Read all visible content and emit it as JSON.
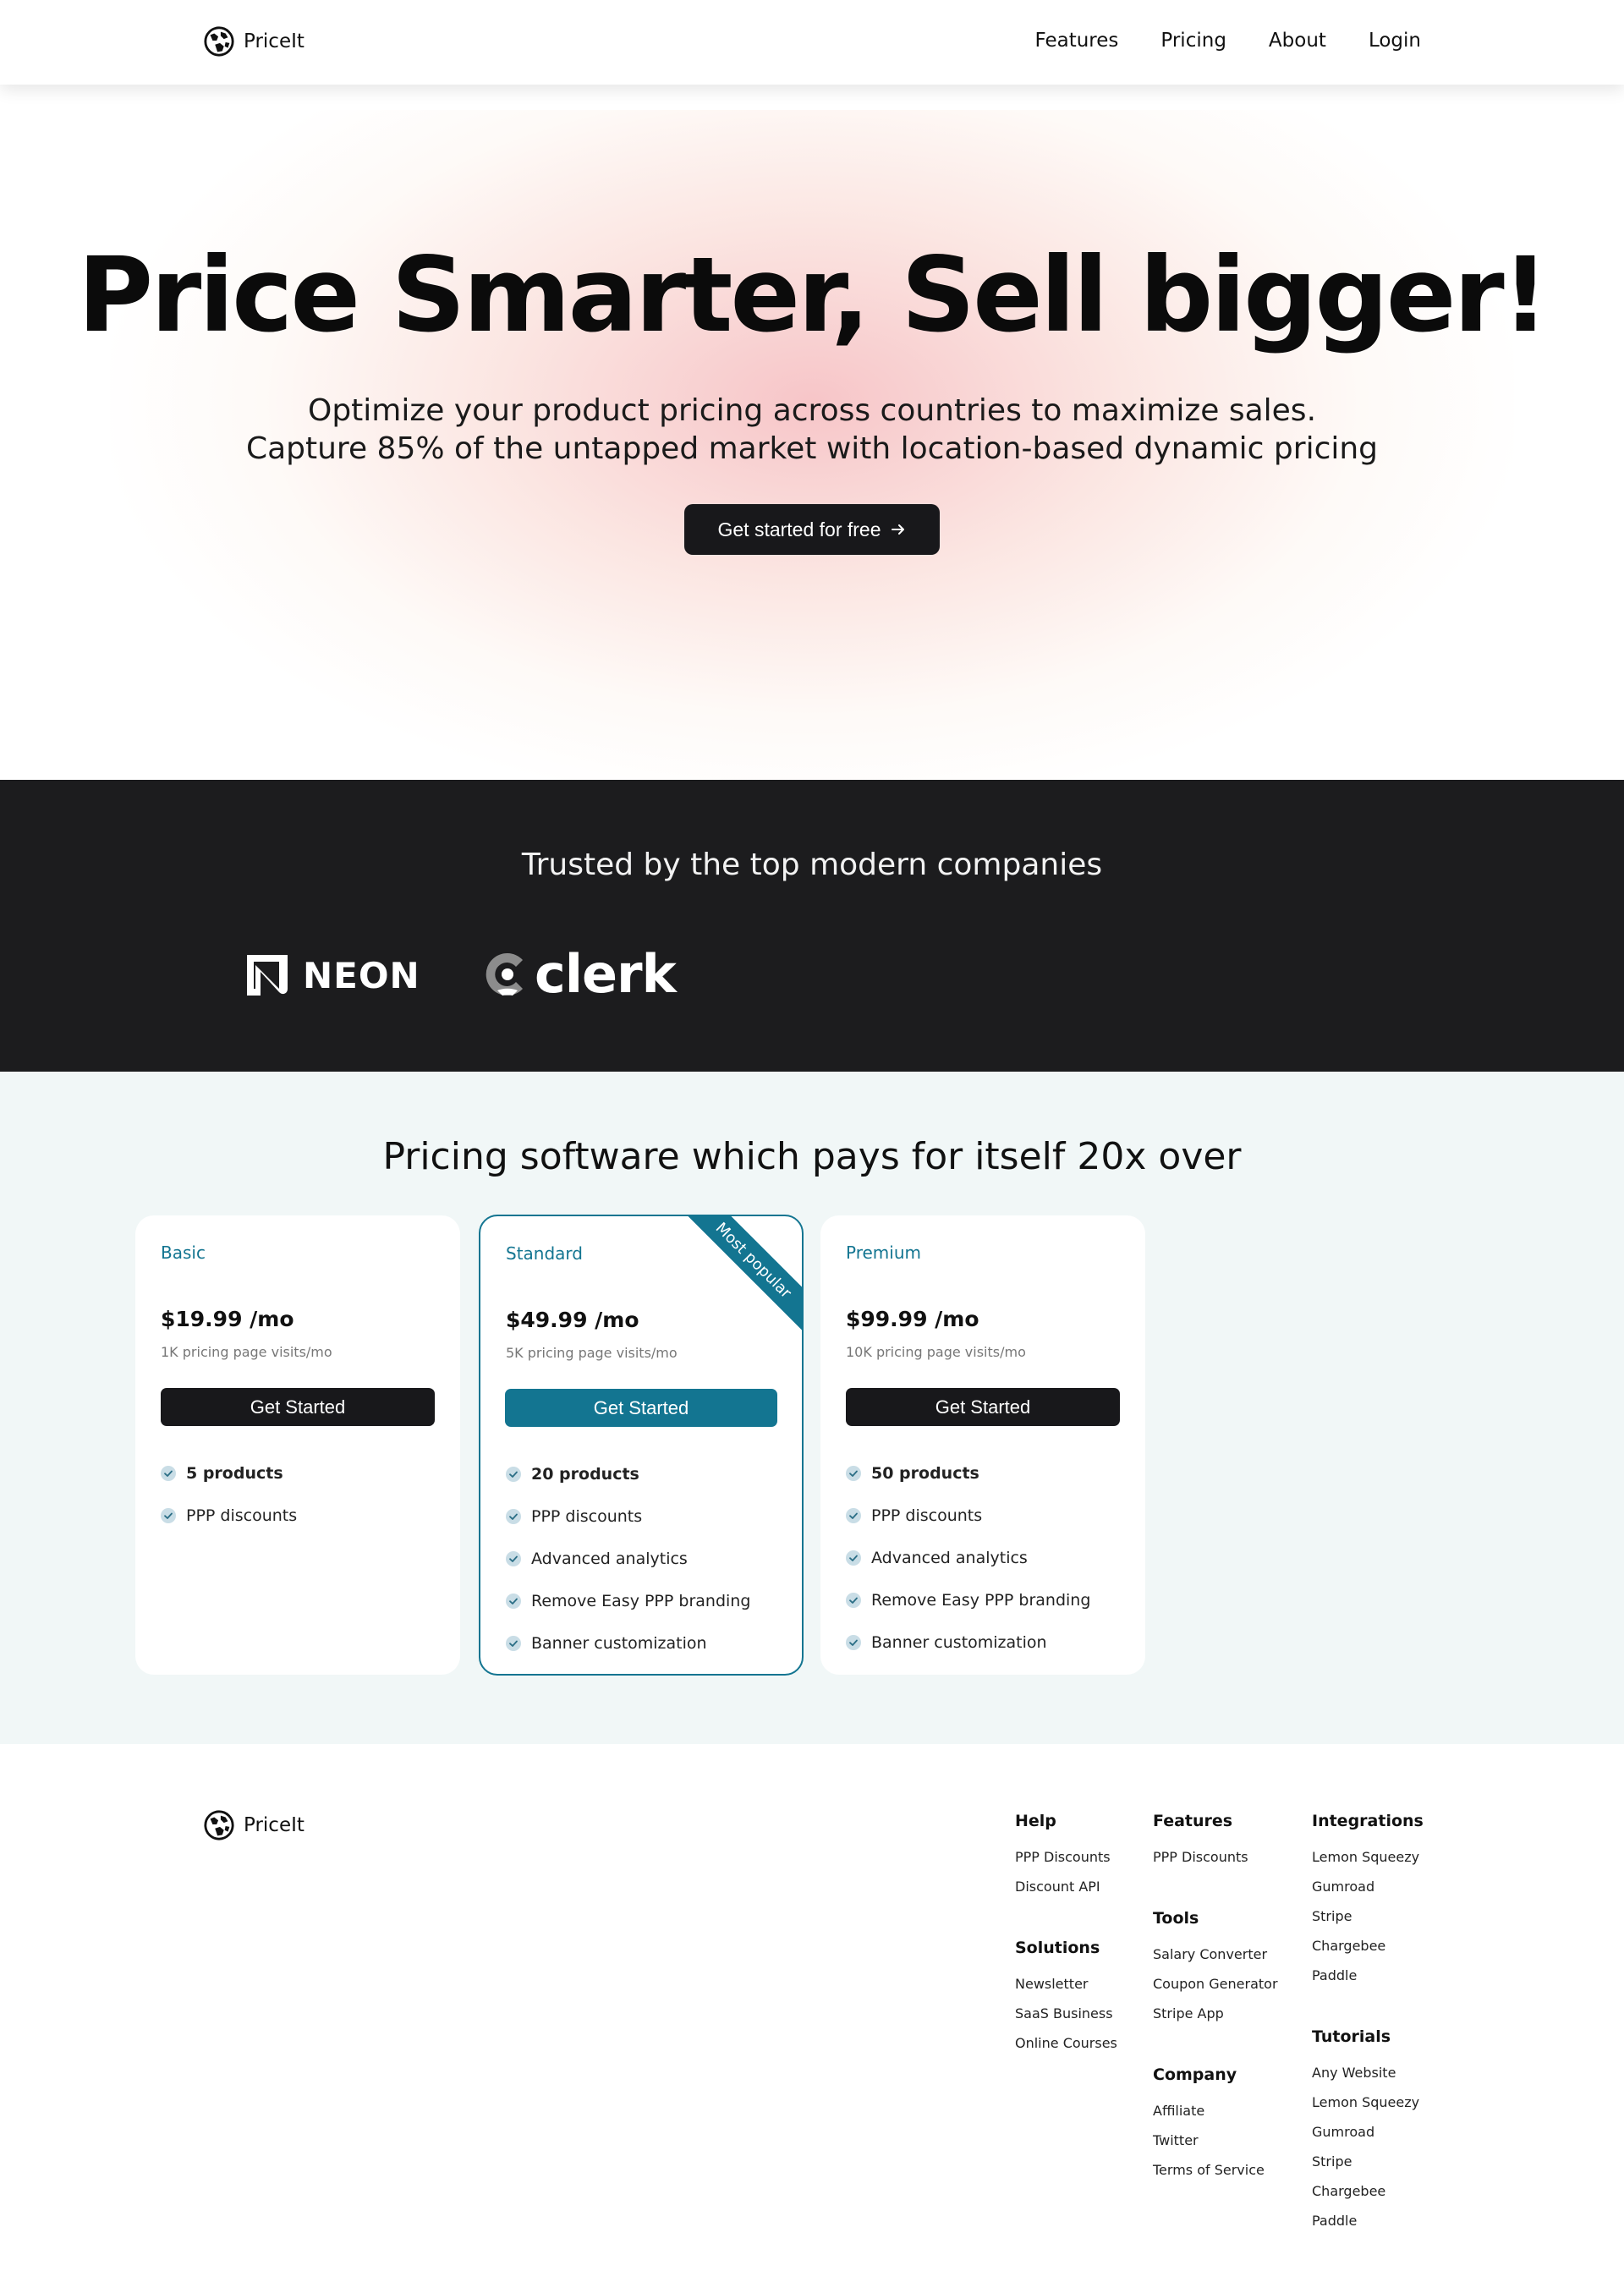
{
  "brand": {
    "name": "PriceIt"
  },
  "nav": [
    {
      "label": "Features"
    },
    {
      "label": "Pricing"
    },
    {
      "label": "About"
    },
    {
      "label": "Login"
    }
  ],
  "hero": {
    "title": "Price Smarter, Sell bigger!",
    "subtitle_line1": "Optimize your product pricing across countries to maximize sales.",
    "subtitle_line2": "Capture 85% of the untapped market with location-based dynamic pricing",
    "cta_label": "Get started for free"
  },
  "trusted": {
    "heading": "Trusted by the top modern companies",
    "logos": [
      "NEON",
      "clerk"
    ]
  },
  "pricing": {
    "heading": "Pricing software which pays for itself 20x over",
    "plans": [
      {
        "name": "Basic",
        "price": "$19.99 /mo",
        "visits": "1K pricing page visits/mo",
        "button": "Get Started",
        "features": [
          "5 products",
          "PPP discounts"
        ]
      },
      {
        "name": "Standard",
        "price": "$49.99 /mo",
        "visits": "5K pricing page visits/mo",
        "button": "Get Started",
        "ribbon": "Most popular",
        "features": [
          "20 products",
          "PPP discounts",
          "Advanced analytics",
          "Remove Easy PPP branding",
          "Banner customization"
        ]
      },
      {
        "name": "Premium",
        "price": "$99.99 /mo",
        "visits": "10K pricing page visits/mo",
        "button": "Get Started",
        "features": [
          "50 products",
          "PPP discounts",
          "Advanced analytics",
          "Remove Easy PPP branding",
          "Banner customization"
        ]
      }
    ]
  },
  "footer": {
    "help": {
      "title": "Help",
      "links": [
        "PPP Discounts",
        "Discount API"
      ]
    },
    "solutions": {
      "title": "Solutions",
      "links": [
        "Newsletter",
        "SaaS Business",
        "Online Courses"
      ]
    },
    "features": {
      "title": "Features",
      "links": [
        "PPP Discounts"
      ]
    },
    "tools": {
      "title": "Tools",
      "links": [
        "Salary Converter",
        "Coupon Generator",
        "Stripe App"
      ]
    },
    "company": {
      "title": "Company",
      "links": [
        "Affiliate",
        "Twitter",
        "Terms of Service"
      ]
    },
    "integrations": {
      "title": "Integrations",
      "links": [
        "Lemon Squeezy",
        "Gumroad",
        "Stripe",
        "Chargebee",
        "Paddle"
      ]
    },
    "tutorials": {
      "title": "Tutorials",
      "links": [
        "Any Website",
        "Lemon Squeezy",
        "Gumroad",
        "Stripe",
        "Chargebee",
        "Paddle"
      ]
    }
  },
  "colors": {
    "accent": "#137591",
    "dark": "#18181b",
    "pricing_bg": "#f1f7f7",
    "trusted_bg": "#1c1c1e"
  },
  "icons": {
    "logo": "globe-logo-icon",
    "arrow": "arrow-right-icon",
    "check": "check-circle-icon"
  }
}
